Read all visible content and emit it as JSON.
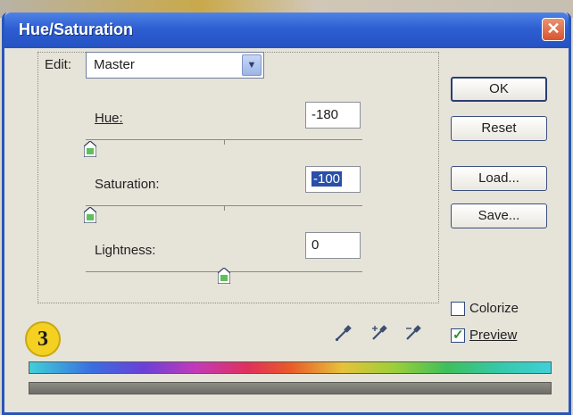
{
  "dialog": {
    "title": "Hue/Saturation",
    "close_glyph": "✕"
  },
  "edit": {
    "label": "Edit:",
    "selected": "Master",
    "arrow_glyph": "▼"
  },
  "hue": {
    "label": "Hue:",
    "value": "-180",
    "slider_level": 0.0
  },
  "saturation": {
    "label": "Saturation:",
    "value": "-100",
    "slider_level": 0.0
  },
  "lightness": {
    "label": "Lightness:",
    "value": "0",
    "slider_level": 0.5
  },
  "buttons": {
    "ok": "OK",
    "reset": "Reset",
    "load": "Load...",
    "save": "Save..."
  },
  "options": {
    "colorize_label": "Colorize",
    "colorize_checked": false,
    "preview_label": "Preview",
    "preview_checked": true,
    "check_glyph": "✓"
  },
  "eyedroppers": [
    "eyedropper-icon",
    "eyedropper-plus-icon",
    "eyedropper-minus-icon"
  ],
  "badge": {
    "number": "3"
  },
  "colors": {
    "titlebar": "#2d5ed2",
    "dialog_bg": "#e6e3d9",
    "badge": "#f3d022",
    "selection": "#2a4fa8"
  }
}
